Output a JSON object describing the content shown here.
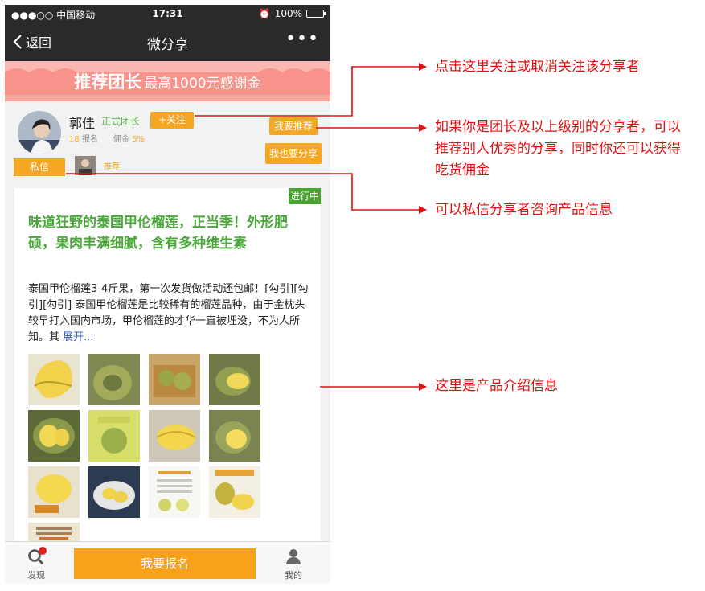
{
  "status_bar": {
    "carrier": "●●●○○ 中国移动",
    "time": "17:31",
    "battery": "100%"
  },
  "nav": {
    "back_label": "返回",
    "title": "微分享",
    "more_label": "•••"
  },
  "banner": {
    "main": "推荐团长",
    "sub": "最高1000元感谢金"
  },
  "profile": {
    "name": "郭佳",
    "badge": "正式团长",
    "follow_label": "+关注",
    "signup_count": "18",
    "signup_label": "报名",
    "commission_label": "佣金",
    "commission_value": "5%",
    "recommend_button": "我要推荐",
    "share_too_button": "我也要分享",
    "private_message_button": "私信",
    "recommender_label": "推荐"
  },
  "product": {
    "status_tag": "进行中",
    "title": "味道狂野的泰国甲伦榴莲，正当季！外形肥硕，果肉丰满细腻，含有多种维生素",
    "description": "泰国甲伦榴莲3-4斤果，第一次发货做活动还包邮！[勾引][勾引][勾引] 泰国甲伦榴莲是比较稀有的榴莲品种，由于金枕头较早打入国内市场，甲伦榴莲的才华一直被埋没，不为人所知。其",
    "expand_label": "展开...",
    "image_count": 13
  },
  "tab_bar": {
    "discover_label": "发现",
    "signup_button": "我要报名",
    "mine_label": "我的"
  },
  "annotations": [
    "点击这里关注或取消关注该分享者",
    "如果你是团长及以上级别的分享者，可以推荐别人优秀的分享，同时你还可以获得吃货佣金",
    "可以私信分享者咨询产品信息",
    "这里是产品介绍信息"
  ],
  "colors": {
    "accent_orange": "#f5a623",
    "banner_pink": "#f7938a",
    "title_green": "#4aa83a",
    "annotation_red": "#e01010",
    "dark_bar": "#2a2a2a"
  }
}
